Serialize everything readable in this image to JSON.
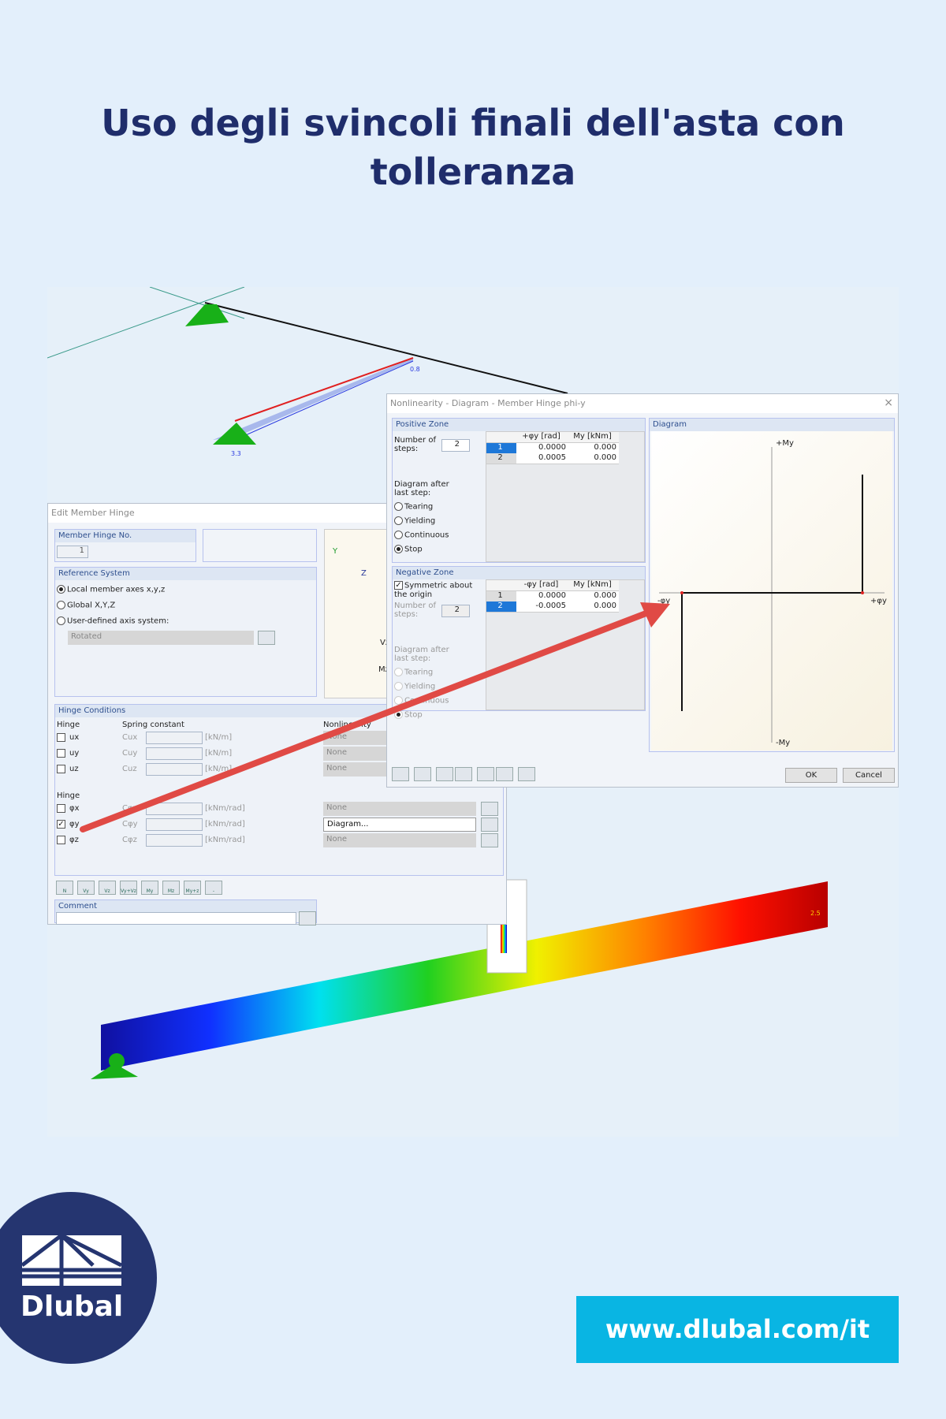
{
  "title": "Uso degli svincoli finali dell'asta con tolleranza",
  "model": {
    "load_label_start": "3.3",
    "load_label_end": "0.8",
    "deform_label": "2.5"
  },
  "edit_hinge": {
    "title": "Edit Member Hinge",
    "hinge_no_label": "Member Hinge No.",
    "hinge_no": "1",
    "ref_label": "Reference System",
    "ref_options": [
      {
        "label": "Local member axes x,y,z",
        "selected": true
      },
      {
        "label": "Global X,Y,Z",
        "selected": false
      },
      {
        "label": "User-defined axis system:",
        "selected": false
      }
    ],
    "ref_combo": "Rotated",
    "axes": {
      "y": "Y",
      "z": "Z",
      "vz": "Vz",
      "mz": "Mz"
    },
    "conditions_label": "Hinge Conditions",
    "hinge_label": "Hinge",
    "spring_label": "Spring constant",
    "nonlinear_label": "Nonlinearity",
    "translations": [
      {
        "name": "ux",
        "spring": "Cux",
        "unit": "[kN/m]",
        "nonlin": "None",
        "checked": false
      },
      {
        "name": "uy",
        "spring": "Cuy",
        "unit": "[kN/m]",
        "nonlin": "None",
        "checked": false
      },
      {
        "name": "uz",
        "spring": "Cuz",
        "unit": "[kN/m]",
        "nonlin": "None",
        "checked": false
      }
    ],
    "hinge_label2": "Hinge",
    "rotations": [
      {
        "name": "φx",
        "spring": "Cφx",
        "unit": "[kNm/rad]",
        "nonlin": "None",
        "checked": false
      },
      {
        "name": "φy",
        "spring": "Cφy",
        "unit": "[kNm/rad]",
        "nonlin": "Diagram...",
        "checked": true
      },
      {
        "name": "φz",
        "spring": "Cφz",
        "unit": "[kNm/rad]",
        "nonlin": "None",
        "checked": false
      }
    ],
    "toolbar": [
      "N",
      "Vy",
      "Vz",
      "Vy+Vz",
      "My",
      "Mz",
      "My+z",
      "-"
    ],
    "comment_label": "Comment"
  },
  "nonlin": {
    "title": "Nonlinearity - Diagram - Member Hinge phi-y",
    "positive": {
      "label": "Positive Zone",
      "steps_label": "Number of steps:",
      "steps": "2",
      "after_label": "Diagram after last step:",
      "options": [
        {
          "label": "Tearing",
          "selected": false
        },
        {
          "label": "Yielding",
          "selected": false
        },
        {
          "label": "Continuous",
          "selected": false
        },
        {
          "label": "Stop",
          "selected": true
        }
      ],
      "columns": [
        "",
        "+φy [rad]",
        "My [kNm]"
      ],
      "rows": [
        [
          "1",
          "0.0000",
          "0.000"
        ],
        [
          "2",
          "0.0005",
          "0.000"
        ]
      ]
    },
    "negative": {
      "label": "Negative Zone",
      "symmetric_label": "Symmetric about the origin",
      "symmetric": true,
      "steps_label": "Number of steps:",
      "steps": "2",
      "after_label": "Diagram after last step:",
      "options": [
        {
          "label": "Tearing",
          "selected": false
        },
        {
          "label": "Yielding",
          "selected": false
        },
        {
          "label": "Continuous",
          "selected": false
        },
        {
          "label": "Stop",
          "selected": true
        }
      ],
      "columns": [
        "",
        "-φy [rad]",
        "My [kNm]"
      ],
      "rows": [
        [
          "1",
          "0.0000",
          "0.000"
        ],
        [
          "2",
          "-0.0005",
          "0.000"
        ]
      ]
    },
    "diagram": {
      "label": "Diagram",
      "pos_my": "+My",
      "neg_my": "-My",
      "pos_phi": "+φy",
      "neg_phi": "-φy"
    },
    "ok": "OK",
    "cancel": "Cancel"
  },
  "brand": {
    "name": "Dlubal",
    "url": "www.dlubal.com/it"
  },
  "colors": {
    "title": "#1f2d6b",
    "logo": "#253570",
    "url_bg": "#09b5e3",
    "arrow": "#e04a45"
  }
}
